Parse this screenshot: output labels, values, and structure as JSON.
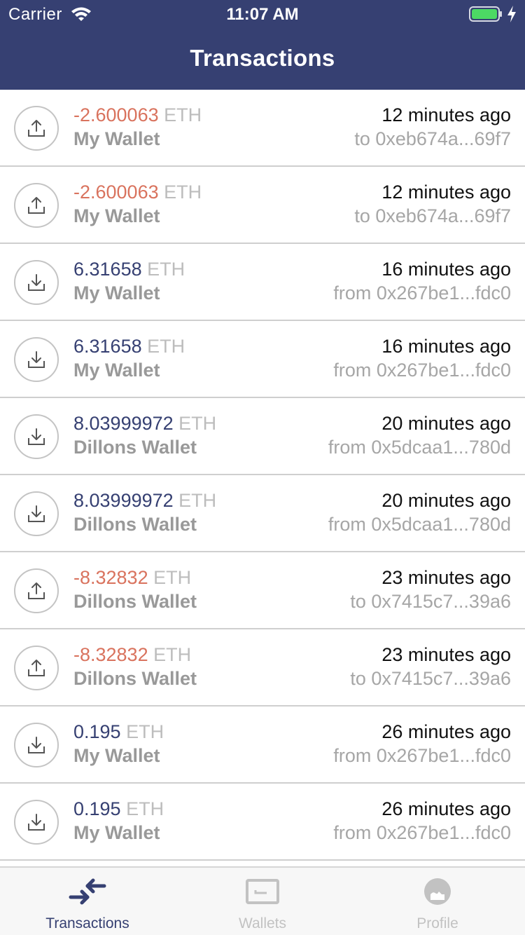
{
  "status_bar": {
    "carrier": "Carrier",
    "time": "11:07 AM"
  },
  "header": {
    "title": "Transactions"
  },
  "transactions": [
    {
      "direction": "sent",
      "amount": "-2.600063",
      "unit": "ETH",
      "wallet": "My Wallet",
      "time": "12 minutes ago",
      "address": "to 0xeb674a...69f7"
    },
    {
      "direction": "sent",
      "amount": "-2.600063",
      "unit": "ETH",
      "wallet": "My Wallet",
      "time": "12 minutes ago",
      "address": "to 0xeb674a...69f7"
    },
    {
      "direction": "received",
      "amount": "6.31658",
      "unit": "ETH",
      "wallet": "My Wallet",
      "time": "16 minutes ago",
      "address": "from 0x267be1...fdc0"
    },
    {
      "direction": "received",
      "amount": "6.31658",
      "unit": "ETH",
      "wallet": "My Wallet",
      "time": "16 minutes ago",
      "address": "from 0x267be1...fdc0"
    },
    {
      "direction": "received",
      "amount": "8.03999972",
      "unit": "ETH",
      "wallet": "Dillons Wallet",
      "time": "20 minutes ago",
      "address": "from 0x5dcaa1...780d"
    },
    {
      "direction": "received",
      "amount": "8.03999972",
      "unit": "ETH",
      "wallet": "Dillons Wallet",
      "time": "20 minutes ago",
      "address": "from 0x5dcaa1...780d"
    },
    {
      "direction": "sent",
      "amount": "-8.32832",
      "unit": "ETH",
      "wallet": "Dillons Wallet",
      "time": "23 minutes ago",
      "address": "to 0x7415c7...39a6"
    },
    {
      "direction": "sent",
      "amount": "-8.32832",
      "unit": "ETH",
      "wallet": "Dillons Wallet",
      "time": "23 minutes ago",
      "address": "to 0x7415c7...39a6"
    },
    {
      "direction": "received",
      "amount": "0.195",
      "unit": "ETH",
      "wallet": "My Wallet",
      "time": "26 minutes ago",
      "address": "from 0x267be1...fdc0"
    },
    {
      "direction": "received",
      "amount": "0.195",
      "unit": "ETH",
      "wallet": "My Wallet",
      "time": "26 minutes ago",
      "address": "from 0x267be1...fdc0"
    }
  ],
  "tabbar": {
    "tabs": [
      {
        "label": "Transactions",
        "icon": "transactions-icon",
        "active": true
      },
      {
        "label": "Wallets",
        "icon": "wallet-icon",
        "active": false
      },
      {
        "label": "Profile",
        "icon": "profile-icon",
        "active": false
      }
    ]
  },
  "colors": {
    "header_bg": "#364072",
    "negative_amount": "#d9735e",
    "positive_amount": "#364072",
    "unit": "#bdbdbd",
    "tab_active": "#364072",
    "tab_inactive": "#c2c2c2"
  }
}
